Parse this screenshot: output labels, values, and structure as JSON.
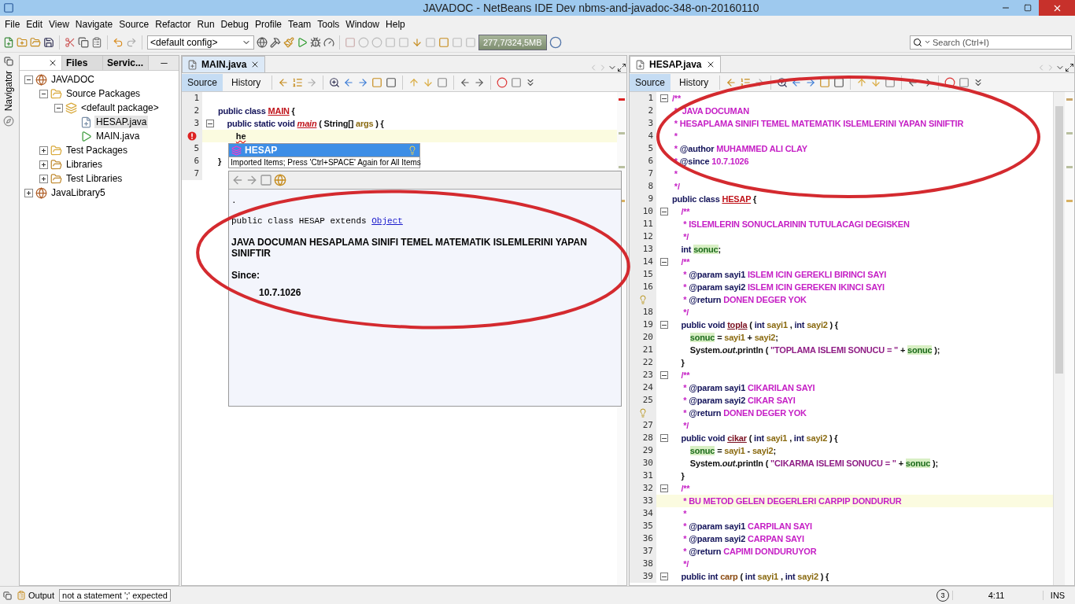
{
  "window": {
    "title": "JAVADOC - NetBeans IDE Dev nbms-and-javadoc-348-on-20160110"
  },
  "menu": [
    "File",
    "Edit",
    "View",
    "Navigate",
    "Source",
    "Refactor",
    "Run",
    "Debug",
    "Profile",
    "Team",
    "Tools",
    "Window",
    "Help"
  ],
  "toolbar": {
    "config": "<default config>",
    "memory": "277,7/324,5MB",
    "search": {
      "placeholder": "Search (Ctrl+I)"
    }
  },
  "navigator": {
    "label": "Navigator"
  },
  "projects_panel": {
    "tabs": [
      {
        "selected": true,
        "closable": true
      },
      {
        "label": "Files",
        "selected": false,
        "closable": false
      },
      {
        "label": "Servic...",
        "selected": false,
        "closable": false
      }
    ],
    "tree": [
      {
        "label": "JAVADOC",
        "kind": "project",
        "expanded": true,
        "selected": false,
        "children": [
          {
            "label": "Source Packages",
            "kind": "folder",
            "expanded": true,
            "selected": false,
            "children": [
              {
                "label": "<default package>",
                "kind": "package",
                "expanded": true,
                "selected": false,
                "children": [
                  {
                    "label": "HESAP.java",
                    "kind": "java",
                    "selected": true
                  },
                  {
                    "label": "MAIN.java",
                    "kind": "main",
                    "selected": false
                  }
                ]
              }
            ]
          },
          {
            "label": "Test Packages",
            "kind": "folder",
            "expanded": false,
            "selected": false
          },
          {
            "label": "Libraries",
            "kind": "library",
            "expanded": false,
            "selected": false
          },
          {
            "label": "Test Libraries",
            "kind": "library",
            "expanded": false,
            "selected": false
          }
        ]
      },
      {
        "label": "JavaLibrary5",
        "kind": "project",
        "expanded": false,
        "selected": false
      }
    ]
  },
  "editors": [
    {
      "tab": {
        "label": "MAIN.java",
        "focused": true
      },
      "views": [
        {
          "label": "Source",
          "selected": true
        },
        {
          "label": "History",
          "selected": false
        }
      ],
      "lines": [
        {
          "num": "1",
          "kind": "code",
          "fold": false,
          "current": false
        },
        {
          "num": "2",
          "kind": "code",
          "fold": false,
          "current": false,
          "tokens": [
            {
              "text": "public class ",
              "kind": "kw"
            },
            {
              "text": "MAIN",
              "kind": "cls"
            },
            {
              "text": " {",
              "kind": "plain"
            }
          ]
        },
        {
          "num": "3",
          "kind": "code",
          "fold": true,
          "current": false,
          "tokens": [
            {
              "text": "    public static void ",
              "kind": "kw"
            },
            {
              "text": "main",
              "kind": "method"
            },
            {
              "text": " ( String[] ",
              "kind": "plain"
            },
            {
              "text": "args",
              "kind": "param"
            },
            {
              "text": " ) {",
              "kind": "plain"
            }
          ]
        },
        {
          "kind": "error",
          "fold": false,
          "current": true,
          "tokens": [
            {
              "text": "        he",
              "kind": "error"
            }
          ]
        },
        {
          "num": "5",
          "kind": "code",
          "fold": false,
          "current": false
        },
        {
          "num": "6",
          "kind": "code",
          "fold": false,
          "current": false,
          "tokens": [
            {
              "text": "}",
              "kind": "plain"
            }
          ]
        },
        {
          "num": "7",
          "kind": "code",
          "fold": false,
          "current": false
        }
      ]
    },
    {
      "tab": {
        "label": "HESAP.java",
        "focused": false
      },
      "views": [
        {
          "label": "Source",
          "selected": true
        },
        {
          "label": "History",
          "selected": false
        }
      ],
      "lines": [
        {
          "num": "1",
          "kind": "code",
          "fold": true,
          "current": false,
          "tokens": [
            {
              "text": "/**",
              "kind": "comment"
            }
          ]
        },
        {
          "num": "2",
          "kind": "code",
          "fold": false,
          "current": false,
          "tokens": [
            {
              "text": " *  JAVA DOCUMAN",
              "kind": "comment"
            }
          ]
        },
        {
          "num": "3",
          "kind": "code",
          "fold": false,
          "current": false,
          "tokens": [
            {
              "text": " * HESAPLAMA SINIFI TEMEL MATEMATIK ISLEMLERINI YAPAN SINIFTIR",
              "kind": "comment"
            }
          ]
        },
        {
          "num": "4",
          "kind": "code",
          "fold": false,
          "current": false,
          "tokens": [
            {
              "text": " *",
              "kind": "comment"
            }
          ]
        },
        {
          "num": "5",
          "kind": "code",
          "fold": false,
          "current": false,
          "tokens": [
            {
              "text": " * ",
              "kind": "comment"
            },
            {
              "text": "@author",
              "kind": "doctag"
            },
            {
              "text": " MUHAMMED ALI CLAY",
              "kind": "comment"
            }
          ]
        },
        {
          "num": "6",
          "kind": "code",
          "fold": false,
          "current": false,
          "tokens": [
            {
              "text": " * ",
              "kind": "comment"
            },
            {
              "text": "@since",
              "kind": "doctag"
            },
            {
              "text": " 10.7.1026",
              "kind": "comment"
            }
          ]
        },
        {
          "num": "7",
          "kind": "code",
          "fold": false,
          "current": false,
          "tokens": [
            {
              "text": " *",
              "kind": "comment"
            }
          ]
        },
        {
          "num": "8",
          "kind": "code",
          "fold": false,
          "current": false,
          "tokens": [
            {
              "text": " */",
              "kind": "comment"
            }
          ]
        },
        {
          "num": "9",
          "kind": "code",
          "fold": false,
          "current": false,
          "tokens": [
            {
              "text": "public class ",
              "kind": "kw"
            },
            {
              "text": "HESAP",
              "kind": "cls"
            },
            {
              "text": " {",
              "kind": "plain"
            }
          ]
        },
        {
          "num": "10",
          "kind": "code",
          "fold": true,
          "current": false,
          "tokens": [
            {
              "text": "    /**",
              "kind": "comment"
            }
          ]
        },
        {
          "num": "11",
          "kind": "code",
          "fold": false,
          "current": false,
          "tokens": [
            {
              "text": "     * ISLEMLERIN SONUCLARININ TUTULACAGI DEGISKEN",
              "kind": "comment"
            }
          ]
        },
        {
          "num": "12",
          "kind": "code",
          "fold": false,
          "current": false,
          "tokens": [
            {
              "text": "     */",
              "kind": "comment"
            }
          ]
        },
        {
          "num": "13",
          "kind": "code",
          "fold": false,
          "current": false,
          "tokens": [
            {
              "text": "    int ",
              "kind": "kw"
            },
            {
              "text": "sonuc",
              "kind": "field"
            },
            {
              "text": ";",
              "kind": "plain"
            }
          ]
        },
        {
          "num": "14",
          "kind": "code",
          "fold": true,
          "current": false,
          "tokens": [
            {
              "text": "    /**",
              "kind": "comment"
            }
          ]
        },
        {
          "num": "15",
          "kind": "code",
          "fold": false,
          "current": false,
          "tokens": [
            {
              "text": "     * ",
              "kind": "comment"
            },
            {
              "text": "@param sayi1",
              "kind": "doctag"
            },
            {
              "text": " ISLEM ICIN GEREKLI BIRINCI SAYI",
              "kind": "comment"
            }
          ]
        },
        {
          "num": "16",
          "kind": "code",
          "fold": false,
          "current": false,
          "tokens": [
            {
              "text": "     * ",
              "kind": "comment"
            },
            {
              "text": "@param sayi2",
              "kind": "doctag"
            },
            {
              "text": " ISLEM ICIN GEREKEN IKINCI SAYI",
              "kind": "comment"
            }
          ]
        },
        {
          "kind": "hint",
          "fold": false,
          "current": false,
          "tokens": [
            {
              "text": "     * ",
              "kind": "comment"
            },
            {
              "text": "@return",
              "kind": "doctag"
            },
            {
              "text": " DONEN DEGER YOK",
              "kind": "comment"
            }
          ]
        },
        {
          "num": "18",
          "kind": "code",
          "fold": false,
          "current": false,
          "tokens": [
            {
              "text": "     */",
              "kind": "comment"
            }
          ]
        },
        {
          "num": "19",
          "kind": "code",
          "fold": true,
          "current": false,
          "tokens": [
            {
              "text": "    public void ",
              "kind": "kw"
            },
            {
              "text": "topla",
              "kind": "decl"
            },
            {
              "text": " ( ",
              "kind": "plain"
            },
            {
              "text": "int ",
              "kind": "kw"
            },
            {
              "text": "sayi1",
              "kind": "param"
            },
            {
              "text": " , ",
              "kind": "plain"
            },
            {
              "text": "int ",
              "kind": "kw"
            },
            {
              "text": "sayi2",
              "kind": "param"
            },
            {
              "text": " ) {",
              "kind": "plain"
            }
          ]
        },
        {
          "num": "20",
          "kind": "code",
          "fold": false,
          "current": false,
          "tokens": [
            {
              "text": "        sonuc",
              "kind": "field"
            },
            {
              "text": " = ",
              "kind": "plain"
            },
            {
              "text": "sayi1",
              "kind": "param"
            },
            {
              "text": " + ",
              "kind": "plain"
            },
            {
              "text": "sayi2",
              "kind": "param"
            },
            {
              "text": ";",
              "kind": "plain"
            }
          ]
        },
        {
          "num": "21",
          "kind": "code",
          "fold": false,
          "current": false,
          "tokens": [
            {
              "text": "        System.",
              "kind": "plain"
            },
            {
              "text": "out",
              "kind": "static"
            },
            {
              "text": ".println ( ",
              "kind": "plain"
            },
            {
              "text": "\"TOPLAMA ISLEMI SONUCU = \"",
              "kind": "string"
            },
            {
              "text": " + ",
              "kind": "plain"
            },
            {
              "text": "sonuc",
              "kind": "field"
            },
            {
              "text": " );",
              "kind": "plain"
            }
          ]
        },
        {
          "num": "22",
          "kind": "code",
          "fold": false,
          "current": false,
          "tokens": [
            {
              "text": "    }",
              "kind": "plain"
            }
          ]
        },
        {
          "num": "23",
          "kind": "code",
          "fold": true,
          "current": false,
          "tokens": [
            {
              "text": "    /**",
              "kind": "comment"
            }
          ]
        },
        {
          "num": "24",
          "kind": "code",
          "fold": false,
          "current": false,
          "tokens": [
            {
              "text": "     * ",
              "kind": "comment"
            },
            {
              "text": "@param sayi1",
              "kind": "doctag"
            },
            {
              "text": " CIKARILAN SAYI",
              "kind": "comment"
            }
          ]
        },
        {
          "num": "25",
          "kind": "code",
          "fold": false,
          "current": false,
          "tokens": [
            {
              "text": "     * ",
              "kind": "comment"
            },
            {
              "text": "@param sayi2",
              "kind": "doctag"
            },
            {
              "text": " CIKAR SAYI",
              "kind": "comment"
            }
          ]
        },
        {
          "kind": "hint",
          "fold": false,
          "current": false,
          "tokens": [
            {
              "text": "     * ",
              "kind": "comment"
            },
            {
              "text": "@return",
              "kind": "doctag"
            },
            {
              "text": " DONEN DEGER YOK",
              "kind": "comment"
            }
          ]
        },
        {
          "num": "27",
          "kind": "code",
          "fold": false,
          "current": false,
          "tokens": [
            {
              "text": "     */",
              "kind": "comment"
            }
          ]
        },
        {
          "num": "28",
          "kind": "code",
          "fold": true,
          "current": false,
          "tokens": [
            {
              "text": "    public void ",
              "kind": "kw"
            },
            {
              "text": "cikar",
              "kind": "decl"
            },
            {
              "text": " ( ",
              "kind": "plain"
            },
            {
              "text": "int ",
              "kind": "kw"
            },
            {
              "text": "sayi1",
              "kind": "param"
            },
            {
              "text": " , ",
              "kind": "plain"
            },
            {
              "text": "int ",
              "kind": "kw"
            },
            {
              "text": "sayi2",
              "kind": "param"
            },
            {
              "text": " ) {",
              "kind": "plain"
            }
          ]
        },
        {
          "num": "29",
          "kind": "code",
          "fold": false,
          "current": false,
          "tokens": [
            {
              "text": "        sonuc",
              "kind": "field"
            },
            {
              "text": " = ",
              "kind": "plain"
            },
            {
              "text": "sayi1",
              "kind": "param"
            },
            {
              "text": " - ",
              "kind": "plain"
            },
            {
              "text": "sayi2",
              "kind": "param"
            },
            {
              "text": ";",
              "kind": "plain"
            }
          ]
        },
        {
          "num": "30",
          "kind": "code",
          "fold": false,
          "current": false,
          "tokens": [
            {
              "text": "        System.",
              "kind": "plain"
            },
            {
              "text": "out",
              "kind": "static"
            },
            {
              "text": ".println ( ",
              "kind": "plain"
            },
            {
              "text": "\"CIKARMA ISLEMI SONUCU = \"",
              "kind": "string"
            },
            {
              "text": " + ",
              "kind": "plain"
            },
            {
              "text": "sonuc",
              "kind": "field"
            },
            {
              "text": " );",
              "kind": "plain"
            }
          ]
        },
        {
          "num": "31",
          "kind": "code",
          "fold": false,
          "current": false,
          "tokens": [
            {
              "text": "    }",
              "kind": "plain"
            }
          ]
        },
        {
          "num": "32",
          "kind": "code",
          "fold": true,
          "current": false,
          "tokens": [
            {
              "text": "    /**",
              "kind": "comment"
            }
          ]
        },
        {
          "num": "33",
          "kind": "code",
          "fold": false,
          "current": true,
          "tokens": [
            {
              "text": "     * BU METOD GELEN DEGERLERI CARPIP DONDURUR",
              "kind": "comment"
            }
          ]
        },
        {
          "num": "34",
          "kind": "code",
          "fold": false,
          "current": false,
          "tokens": [
            {
              "text": "     *",
              "kind": "comment"
            }
          ]
        },
        {
          "num": "35",
          "kind": "code",
          "fold": false,
          "current": false,
          "tokens": [
            {
              "text": "     * ",
              "kind": "comment"
            },
            {
              "text": "@param sayi1",
              "kind": "doctag"
            },
            {
              "text": " CARPILAN SAYI",
              "kind": "comment"
            }
          ]
        },
        {
          "num": "36",
          "kind": "code",
          "fold": false,
          "current": false,
          "tokens": [
            {
              "text": "     * ",
              "kind": "comment"
            },
            {
              "text": "@param sayi2",
              "kind": "doctag"
            },
            {
              "text": " CARPAN SAYI",
              "kind": "comment"
            }
          ]
        },
        {
          "num": "37",
          "kind": "code",
          "fold": false,
          "current": false,
          "tokens": [
            {
              "text": "     * ",
              "kind": "comment"
            },
            {
              "text": "@return",
              "kind": "doctag"
            },
            {
              "text": " CAPIMI DONDURUYOR",
              "kind": "comment"
            }
          ]
        },
        {
          "num": "38",
          "kind": "code",
          "fold": false,
          "current": false,
          "tokens": [
            {
              "text": "     */",
              "kind": "comment"
            }
          ]
        },
        {
          "num": "39",
          "kind": "code",
          "fold": true,
          "current": false,
          "tokens": [
            {
              "text": "    public int ",
              "kind": "kw"
            },
            {
              "text": "carp",
              "kind": "decl2"
            },
            {
              "text": " ( ",
              "kind": "plain"
            },
            {
              "text": "int ",
              "kind": "kw"
            },
            {
              "text": "sayi1",
              "kind": "param"
            },
            {
              "text": " , ",
              "kind": "plain"
            },
            {
              "text": "int ",
              "kind": "kw"
            },
            {
              "text": "sayi2",
              "kind": "param"
            },
            {
              "text": " ) {",
              "kind": "plain"
            }
          ]
        }
      ]
    }
  ],
  "completion": {
    "items": [
      {
        "label": "HESAP",
        "selected": true
      }
    ],
    "hint": "Imported Items; Press 'Ctrl+SPACE' Again for All Items",
    "doc": {
      "dot": ".",
      "signature": "public class HESAP extends ",
      "link": "Object",
      "description": "JAVA DOCUMAN HESAPLAMA SINIFI TEMEL MATEMATIK ISLEMLERINI YAPAN SINIFTIR",
      "since_label": "Since:",
      "since": "10.7.1026"
    }
  },
  "status_bar": {
    "output": "Output",
    "message": "not a statement  ';' expected",
    "notifications": "3",
    "position": "4:11",
    "mode": "INS"
  }
}
